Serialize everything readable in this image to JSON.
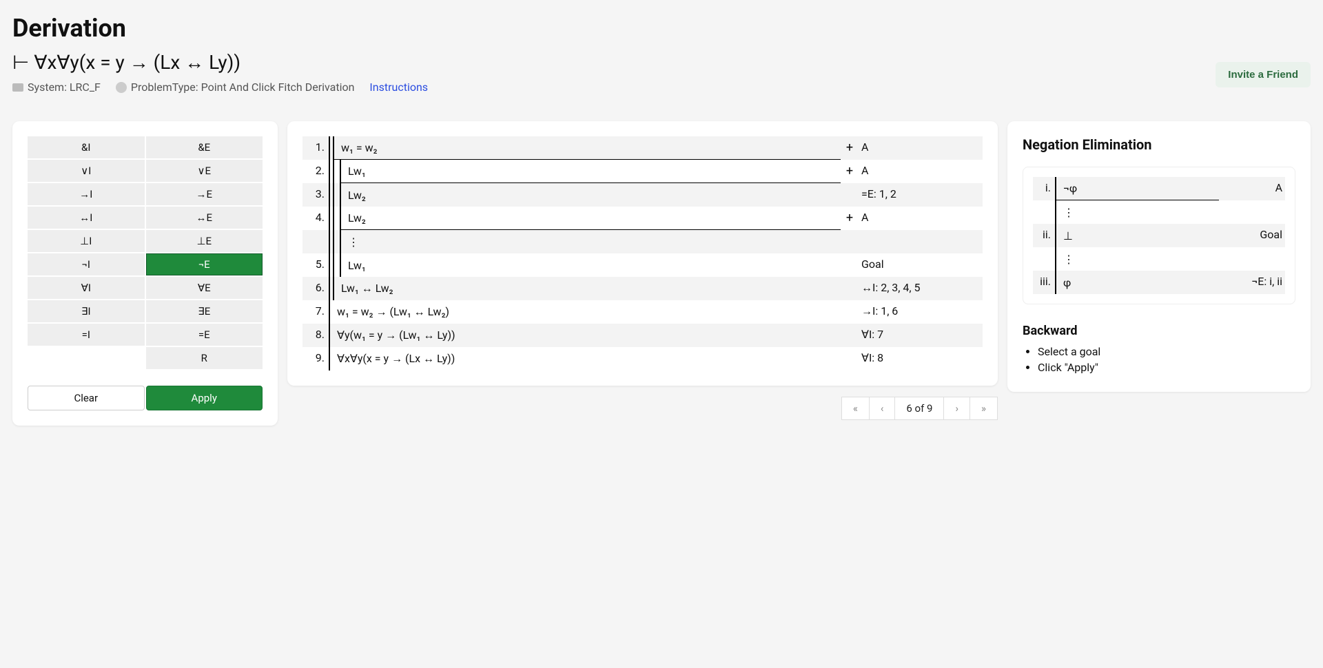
{
  "header": {
    "title": "Derivation",
    "problem": "⊢  ∀x∀y(x = y → (Lx ↔ Ly))",
    "system_label": "System: LRC_F",
    "problemtype_label": "ProblemType: Point And Click Fitch Derivation",
    "instructions_label": "Instructions",
    "invite_label": "Invite a Friend"
  },
  "rules": [
    {
      "label": "&I",
      "selected": false
    },
    {
      "label": "&E",
      "selected": false
    },
    {
      "label": "∨I",
      "selected": false
    },
    {
      "label": "∨E",
      "selected": false
    },
    {
      "label": "→I",
      "selected": false
    },
    {
      "label": "→E",
      "selected": false
    },
    {
      "label": "↔I",
      "selected": false
    },
    {
      "label": "↔E",
      "selected": false
    },
    {
      "label": "⊥I",
      "selected": false
    },
    {
      "label": "⊥E",
      "selected": false
    },
    {
      "label": "¬I",
      "selected": false
    },
    {
      "label": "¬E",
      "selected": true
    },
    {
      "label": "∀I",
      "selected": false
    },
    {
      "label": "∀E",
      "selected": false
    },
    {
      "label": "∃I",
      "selected": false
    },
    {
      "label": "∃E",
      "selected": false
    },
    {
      "label": "=I",
      "selected": false
    },
    {
      "label": "=E",
      "selected": false
    },
    {
      "label": "",
      "selected": false,
      "empty": true
    },
    {
      "label": "R",
      "selected": false
    }
  ],
  "buttons": {
    "clear": "Clear",
    "apply": "Apply"
  },
  "proof": [
    {
      "n": "1.",
      "depth": 1,
      "formula": "w₁ = w₂",
      "plus": true,
      "just": "A",
      "underline": true,
      "striped": true
    },
    {
      "n": "2.",
      "depth": 2,
      "formula": "Lw₁",
      "plus": true,
      "just": "A",
      "underline": true,
      "striped": false
    },
    {
      "n": "3.",
      "depth": 2,
      "formula": "Lw₂",
      "plus": false,
      "just": "=E: 1, 2",
      "striped": true
    },
    {
      "n": "4.",
      "depth": 2,
      "formula": "Lw₂",
      "plus": true,
      "just": "A",
      "underline": true,
      "striped": false
    },
    {
      "n": "",
      "depth": 2,
      "formula": "⋮",
      "plus": false,
      "just": "",
      "striped": true,
      "isdots": true
    },
    {
      "n": "5.",
      "depth": 2,
      "formula": "Lw₁",
      "plus": false,
      "just": "Goal",
      "striped": false
    },
    {
      "n": "6.",
      "depth": 1,
      "formula": "Lw₁ ↔ Lw₂",
      "plus": false,
      "just": "↔I: 2, 3, 4, 5",
      "striped": true
    },
    {
      "n": "7.",
      "depth": 0,
      "formula": "w₁ = w₂ → (Lw₁ ↔ Lw₂)",
      "plus": false,
      "just": "→I: 1, 6",
      "striped": false
    },
    {
      "n": "8.",
      "depth": 0,
      "formula": "∀y(w₁ = y → (Lw₁ ↔ Ly))",
      "plus": false,
      "just": "∀I: 7",
      "striped": true
    },
    {
      "n": "9.",
      "depth": 0,
      "formula": "∀x∀y(x = y → (Lx ↔ Ly))",
      "plus": false,
      "just": "∀I: 8",
      "striped": false
    }
  ],
  "pager": {
    "first": "«",
    "prev": "‹",
    "text": "6 of 9",
    "next": "›",
    "last": "»"
  },
  "help": {
    "title": "Negation Elimination",
    "schema": [
      {
        "n": "i.",
        "formula": "¬φ",
        "just": "A",
        "underline": true,
        "striped": true
      },
      {
        "n": "",
        "formula": "⋮",
        "just": "",
        "isdots": true
      },
      {
        "n": "ii.",
        "formula": "⊥",
        "just": "Goal",
        "striped": true
      },
      {
        "n": "",
        "formula": "⋮",
        "just": "",
        "isdots": true
      },
      {
        "n": "iii.",
        "formula": "φ",
        "just": "¬E: i, ii",
        "striped": true
      }
    ],
    "subhead": "Backward",
    "steps": [
      "Select a goal",
      "Click \"Apply\""
    ]
  }
}
